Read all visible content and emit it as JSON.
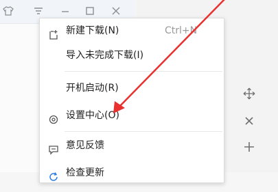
{
  "menu": {
    "items": [
      {
        "label": "新建下载(N)",
        "shortcut": "Ctrl+N",
        "icon": "new-download-icon"
      },
      {
        "label": "导入未完成下载(I)"
      },
      {
        "label": "开机启动(R)"
      },
      {
        "label": "设置中心(O)",
        "icon": "gear-icon"
      },
      {
        "label": "意见反馈",
        "icon": "feedback-icon"
      },
      {
        "label": "检查更新",
        "icon": "refresh-icon"
      }
    ]
  },
  "annotation": {
    "arrow_color": "#e8312f"
  },
  "side_actions": [
    "move-icon",
    "close-icon",
    "add-icon"
  ]
}
